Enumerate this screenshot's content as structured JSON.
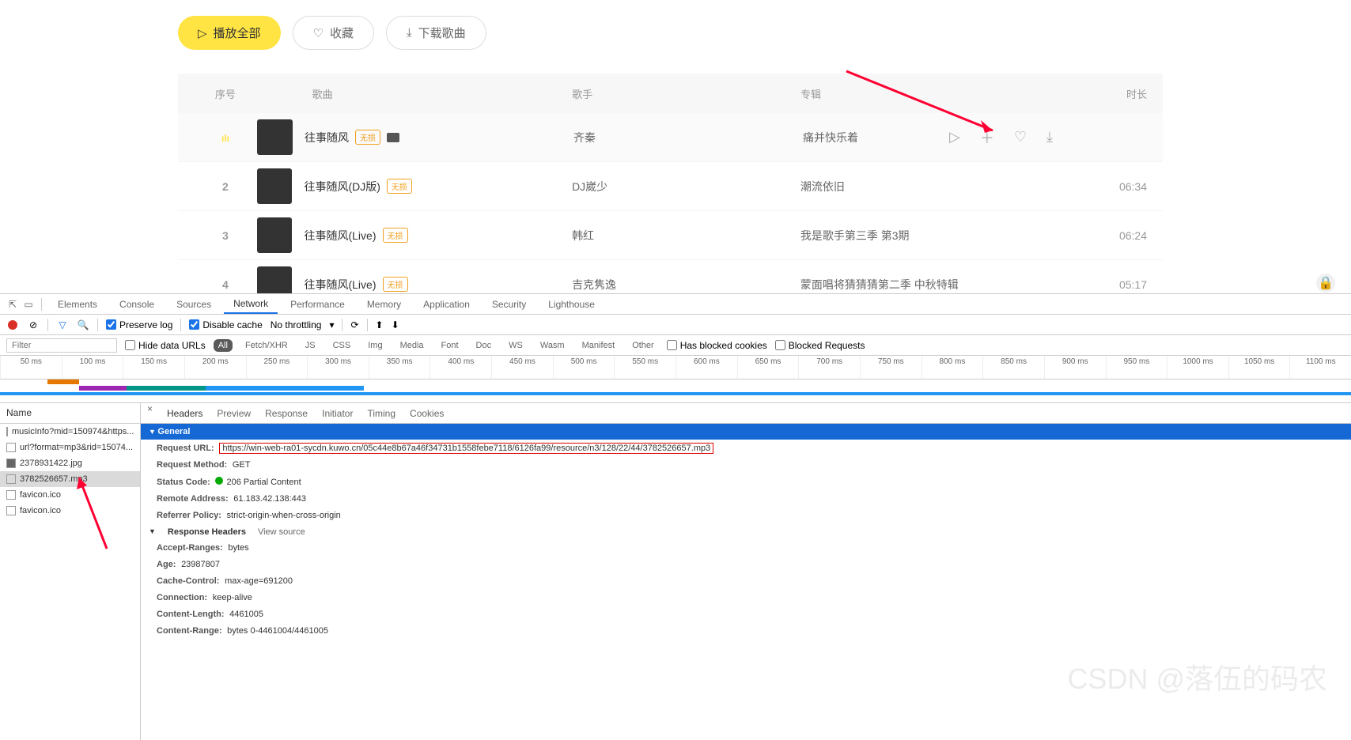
{
  "actions": {
    "play_all": "播放全部",
    "favorite": "收藏",
    "download": "下载歌曲"
  },
  "columns": {
    "index": "序号",
    "song": "歌曲",
    "artist": "歌手",
    "album": "专辑",
    "duration": "时长"
  },
  "songs": [
    {
      "index": "",
      "playing": true,
      "title": "往事随风",
      "badge": "无损",
      "extra": true,
      "artist": "齐秦",
      "album": "痛并快乐着",
      "duration": ""
    },
    {
      "index": "2",
      "title": "往事随风(DJ版)",
      "badge": "无损",
      "artist": "DJ崴少",
      "album": "潮流依旧",
      "duration": "06:34"
    },
    {
      "index": "3",
      "title": "往事随风(Live)",
      "badge": "无损",
      "artist": "韩红",
      "album": "我是歌手第三季 第3期",
      "duration": "06:24"
    },
    {
      "index": "4",
      "title": "往事随风(Live)",
      "badge": "无损",
      "artist": "吉克隽逸",
      "album": "蒙面唱将猜猜猜第二季 中秋特辑",
      "duration": "05:17"
    }
  ],
  "devtools": {
    "tabs": [
      "Elements",
      "Console",
      "Sources",
      "Network",
      "Performance",
      "Memory",
      "Application",
      "Security",
      "Lighthouse"
    ],
    "active_tab": "Network",
    "preserve_log": "Preserve log",
    "disable_cache": "Disable cache",
    "throttling": "No throttling",
    "filter_placeholder": "Filter",
    "hide_data_urls": "Hide data URLs",
    "filter_types": [
      "All",
      "Fetch/XHR",
      "JS",
      "CSS",
      "Img",
      "Media",
      "Font",
      "Doc",
      "WS",
      "Wasm",
      "Manifest",
      "Other"
    ],
    "has_blocked_cookies": "Has blocked cookies",
    "blocked_requests": "Blocked Requests",
    "timeline_ticks": [
      "50 ms",
      "100 ms",
      "150 ms",
      "200 ms",
      "250 ms",
      "300 ms",
      "350 ms",
      "400 ms",
      "450 ms",
      "500 ms",
      "550 ms",
      "600 ms",
      "650 ms",
      "700 ms",
      "750 ms",
      "800 ms",
      "850 ms",
      "900 ms",
      "950 ms",
      "1000 ms",
      "1050 ms",
      "1100 ms"
    ],
    "name_header": "Name",
    "detail_tabs": [
      "Headers",
      "Preview",
      "Response",
      "Initiator",
      "Timing",
      "Cookies"
    ],
    "requests": [
      "musicInfo?mid=150974&https...",
      "url?format=mp3&rid=15074...",
      "2378931422.jpg",
      "3782526657.mp3",
      "favicon.ico",
      "favicon.ico"
    ],
    "selected_request_index": 3,
    "general": {
      "title": "General",
      "request_url_k": "Request URL:",
      "request_url_v": "https://win-web-ra01-sycdn.kuwo.cn/05c44e8b67a46f34731b1558febe7118/6126fa99/resource/n3/128/22/44/3782526657.mp3",
      "request_method_k": "Request Method:",
      "request_method_v": "GET",
      "status_code_k": "Status Code:",
      "status_code_v": "206 Partial Content",
      "remote_address_k": "Remote Address:",
      "remote_address_v": "61.183.42.138:443",
      "referrer_policy_k": "Referrer Policy:",
      "referrer_policy_v": "strict-origin-when-cross-origin"
    },
    "response_headers": {
      "title": "Response Headers",
      "view_source": "View source",
      "items": [
        {
          "k": "Accept-Ranges:",
          "v": "bytes"
        },
        {
          "k": "Age:",
          "v": "23987807"
        },
        {
          "k": "Cache-Control:",
          "v": "max-age=691200"
        },
        {
          "k": "Connection:",
          "v": "keep-alive"
        },
        {
          "k": "Content-Length:",
          "v": "4461005"
        },
        {
          "k": "Content-Range:",
          "v": "bytes 0-4461004/4461005"
        }
      ]
    }
  },
  "watermark": "CSDN @落伍的码农"
}
